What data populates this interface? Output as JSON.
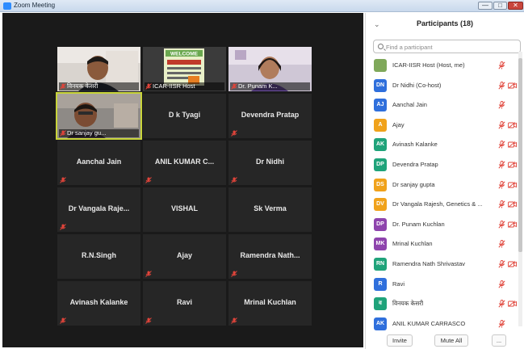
{
  "window": {
    "title": "Zoom Meeting",
    "controls": {
      "minimize": "—",
      "maximize": "□",
      "close": "✕"
    }
  },
  "colors": {
    "mic_muted": "#e0443a",
    "active_speaker": "#c8d43a",
    "gallery_bg": "#1a1a1a",
    "tile_bg": "#262626"
  },
  "gallery": {
    "video_tiles": [
      {
        "label": "विनयक केसरी"
      },
      {
        "label": "ICAR-IISR Host",
        "sign_text": "WELCOME"
      },
      {
        "label": "Dr. Punam K..."
      },
      {
        "label": "Dr sanjay gu..."
      }
    ],
    "name_tiles": [
      "D k Tyagi",
      "Devendra Pratap",
      "Aanchal Jain",
      "ANIL KUMAR C...",
      "Dr Nidhi",
      "Dr Vangala Raje...",
      "VISHAL",
      "Sk Verma",
      "R.N.Singh",
      "Ajay",
      "Ramendra Nath...",
      "Avinash Kalanke",
      "Ravi",
      "Mrinal Kuchlan"
    ]
  },
  "participants": {
    "title": "Participants (18)",
    "collapse_icon": "chevron-down-icon",
    "search_placeholder": "Find a participant",
    "list": [
      {
        "initials": "",
        "name": "ICAR-IISR Host (Host, me)",
        "color": "#7fa85a",
        "cam": false
      },
      {
        "initials": "DN",
        "name": "Dr Nidhi (Co-host)",
        "color": "#2f6fdc",
        "cam": true
      },
      {
        "initials": "AJ",
        "name": "Aanchal Jain",
        "color": "#2f6fdc",
        "cam": false
      },
      {
        "initials": "A",
        "name": "Ajay",
        "color": "#f0a21b",
        "cam": true
      },
      {
        "initials": "AK",
        "name": "Avinash Kalanke",
        "color": "#1fa37a",
        "cam": true
      },
      {
        "initials": "DP",
        "name": "Devendra Pratap",
        "color": "#1fa37a",
        "cam": true
      },
      {
        "initials": "DS",
        "name": "Dr sanjay gupta",
        "color": "#f0a21b",
        "cam": true
      },
      {
        "initials": "DV",
        "name": "Dr Vangala Rajesh, Genetics & ...",
        "color": "#f0a21b",
        "cam": true
      },
      {
        "initials": "DP",
        "name": "Dr. Punam Kuchlan",
        "color": "#8e44ad",
        "cam": true
      },
      {
        "initials": "MK",
        "name": "Mrinal Kuchlan",
        "color": "#8e44ad",
        "cam": false
      },
      {
        "initials": "RN",
        "name": "Ramendra Nath Shrivastav",
        "color": "#1fa37a",
        "cam": true
      },
      {
        "initials": "R",
        "name": "Ravi",
        "color": "#2f6fdc",
        "cam": false
      },
      {
        "initials": "व",
        "name": "विनयक केसरी",
        "color": "#1fa37a",
        "cam": true
      },
      {
        "initials": "AK",
        "name": "ANIL KUMAR CARRASCO",
        "color": "#2f6fdc",
        "cam": false
      }
    ],
    "buttons": {
      "invite": "Invite",
      "mute_all": "Mute All",
      "more": "..."
    }
  }
}
